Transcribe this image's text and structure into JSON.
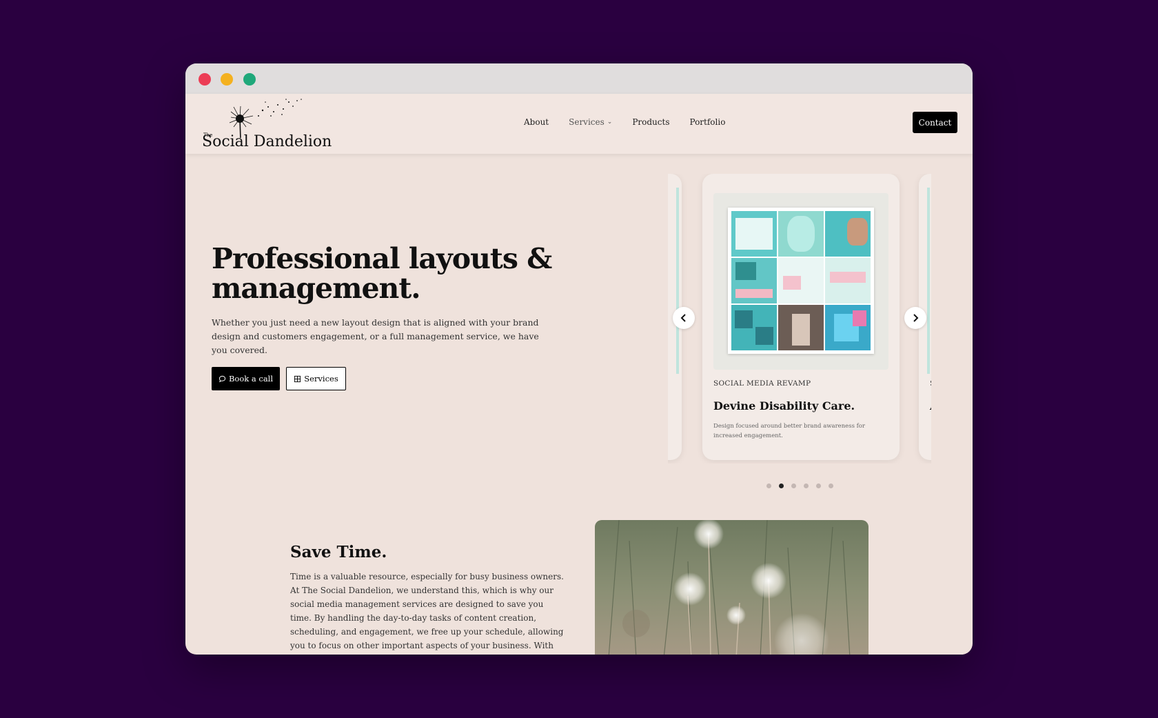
{
  "window": {
    "controls": [
      "close",
      "minimize",
      "maximize"
    ]
  },
  "nav": {
    "logo_small": "The",
    "logo_text": "Social Dandelion",
    "links": [
      "About",
      "Services",
      "Products",
      "Portfolio"
    ],
    "contact": "Contact"
  },
  "hero": {
    "title": "Professional layouts & management.",
    "subtitle": "Whether you just need a new layout design that is aligned with your brand design and customers engagement, or a full management service, we have you covered.",
    "book_call": "Book a call",
    "services": "Services"
  },
  "carousel": {
    "card_tag": "SOCIAL MEDIA REVAMP",
    "card_title": "Devine Disability Care.",
    "card_desc": "Design focused around better brand awareness for increased engagement.",
    "peek_tag": "S",
    "peek_title": "A",
    "total_slides": 6,
    "active_slide": 2
  },
  "save_time": {
    "title": "Save Time.",
    "body": "Time is a valuable resource, especially for busy business owners. At The Social Dandelion, we understand this, which is why our social media management services are designed to save you time. By handling the day-to-day tasks of content creation, scheduling, and engagement, we free up your schedule, allowing you to focus on other important aspects of your business. With our time-saving solutions,"
  },
  "colors": {
    "page_bg": "#2a0040",
    "window_bg": "#efe2dc",
    "accent": "#000000"
  }
}
